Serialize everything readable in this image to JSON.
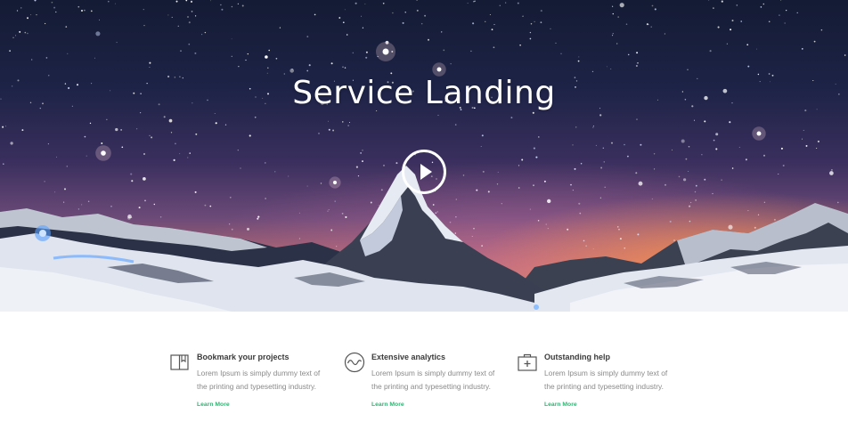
{
  "hero": {
    "title": "Service Landing",
    "play_icon": "play-icon"
  },
  "features": [
    {
      "icon": "book-icon",
      "title": "Bookmark your projects",
      "text": "Lorem Ipsum is simply dummy text of the printing and typesetting industry.",
      "link": "Learn More"
    },
    {
      "icon": "pulse-icon",
      "title": "Extensive analytics",
      "text": "Lorem Ipsum is simply dummy text of the printing and typesetting industry.",
      "link": "Learn More"
    },
    {
      "icon": "medical-kit-icon",
      "title": "Outstanding help",
      "text": "Lorem Ipsum is simply dummy text of the printing and typesetting industry.",
      "link": "Learn More"
    }
  ],
  "colors": {
    "accent": "#2bb673",
    "heading": "#3b3b3b",
    "body_text": "#8a8a8a"
  }
}
